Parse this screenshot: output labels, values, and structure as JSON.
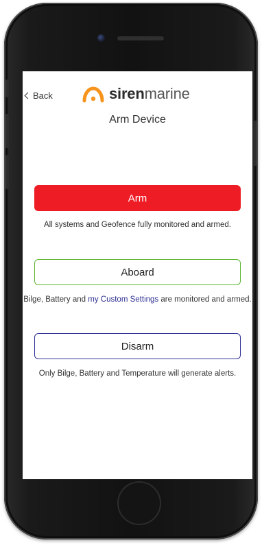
{
  "header": {
    "back_label": "Back",
    "brand_bold": "siren",
    "brand_light": "marine",
    "title": "Arm Device"
  },
  "modes": {
    "arm": {
      "label": "Arm",
      "description": "All systems and Geofence fully monitored and armed."
    },
    "aboard": {
      "label": "Aboard",
      "description_prefix": "Bilge, Battery and ",
      "description_link": "my Custom Settings",
      "description_suffix": " are monitored and armed."
    },
    "disarm": {
      "label": "Disarm",
      "description": "Only Bilge, Battery and Temperature will generate alerts."
    }
  },
  "colors": {
    "arm_red": "#ee1c25",
    "aboard_green": "#5cb531",
    "disarm_navy": "#2e3192",
    "brand_orange": "#f7941d"
  },
  "icons": {
    "logo": "siren-arc-icon",
    "back": "chevron-left-icon"
  }
}
